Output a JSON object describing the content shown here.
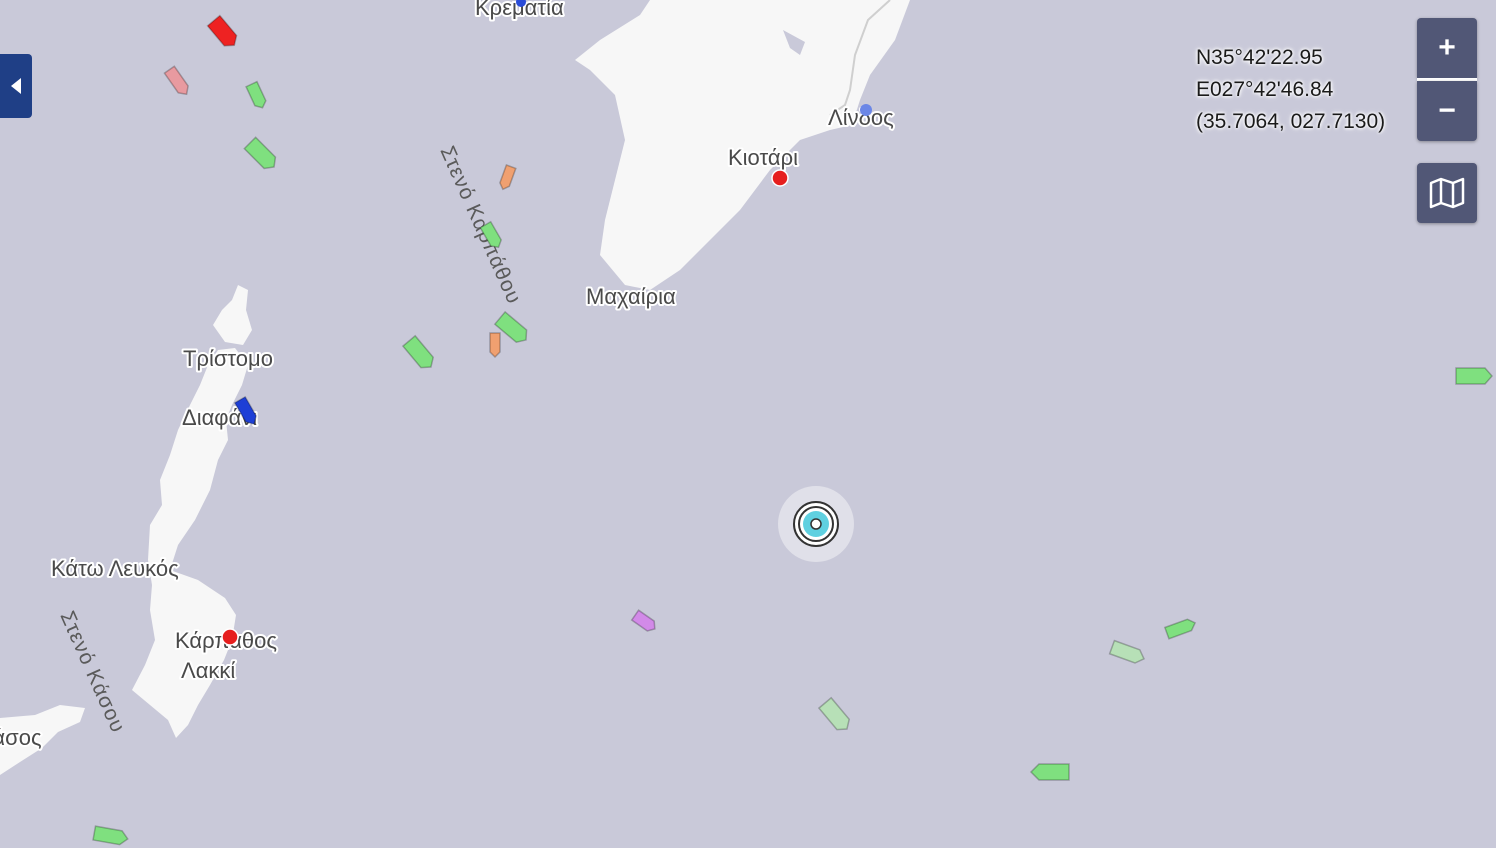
{
  "map": {
    "colors": {
      "sea": "#c9c9d9",
      "land": "#f7f7f7",
      "control_bg": "#515776",
      "panel_toggle_bg": "#1f3f86"
    },
    "places": {
      "kremastia": "Κρεματία",
      "lindos": "Λίνδος",
      "kiotari": "Κιοτάρι",
      "machairia": "Μαχαίρια",
      "tristomo": "Τρίστομο",
      "diafani": "Διαφάνι",
      "kato_lefkos": "Κάτω Λευκός",
      "karpathos": "Κάρπαθος",
      "lakki": "Λακκί",
      "kasos": "Κάσος"
    },
    "straits": {
      "karpathos_strait": "Στενό Καρπάθου",
      "kasos_strait": "Στενό Κάσου"
    }
  },
  "coordinates": {
    "lat": "N35°42'22.95",
    "lon": "E027°42'46.84",
    "decimal": "(35.7064, 027.7130)"
  },
  "controls": {
    "zoom_in": "+",
    "zoom_out": "−",
    "layers_icon": "map-layers-icon",
    "panel_toggle_icon": "chevron-left-icon"
  },
  "vessels": {
    "colors": {
      "cargo": "#7fe07f",
      "tanker": "#ee2222",
      "tanker_faded": "#e89aa0",
      "passenger": "#1e3fd6",
      "tug": "#f0a070",
      "pleasure": "#d28ae8",
      "cargo_faded": "#b7e0b7"
    }
  }
}
